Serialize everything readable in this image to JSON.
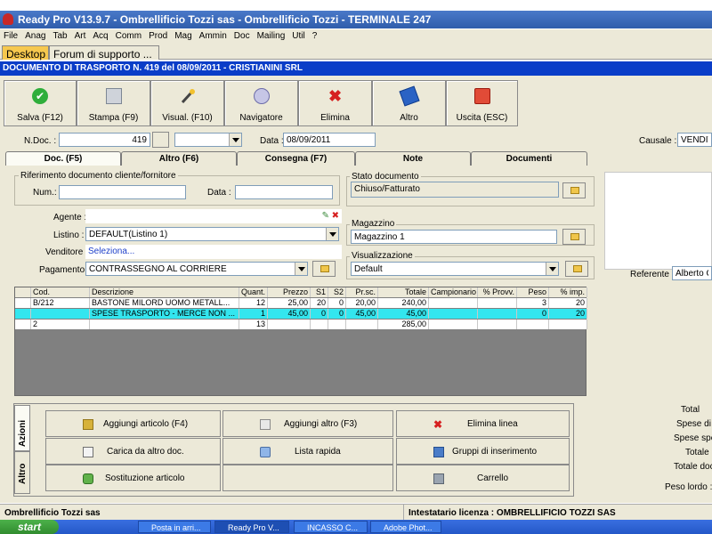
{
  "window": {
    "title": "Ready Pro V13.9.7 - Ombrellificio Tozzi sas - Ombrellificio Tozzi - TERMINALE 247"
  },
  "menu": [
    "File",
    "Anag",
    "Tab",
    "Art",
    "Acq",
    "Comm",
    "Prod",
    "Mag",
    "Ammin",
    "Doc",
    "Mailing",
    "Util",
    "?"
  ],
  "top_tabs": {
    "desktop": "Desktop",
    "forum": "Forum di supporto ..."
  },
  "doc_header": "DOCUMENTO DI TRASPORTO N. 419  del 08/09/2011 - CRISTIANINI SRL",
  "toolbar": {
    "save": "Salva (F12)",
    "print": "Stampa (F9)",
    "view": "Visual. (F10)",
    "navigator": "Navigatore",
    "delete": "Elimina",
    "other": "Altro",
    "exit": "Uscita (ESC)"
  },
  "header_fields": {
    "ndoc_label": "N.Doc. :",
    "ndoc_value": "419",
    "date_label": "Data :",
    "date_value": "08/09/2011",
    "causale_label": "Causale :",
    "causale_value": "VENDITA"
  },
  "sub_tabs": {
    "doc": "Doc. (F5)",
    "altro": "Altro (F6)",
    "consegna": "Consegna (F7)",
    "note": "Note",
    "documenti": "Documenti"
  },
  "rif_group": {
    "title": "Riferimento documento cliente/fornitore",
    "num_label": "Num.:",
    "data_label": "Data :"
  },
  "stato_group": {
    "title": "Stato documento",
    "value": "Chiuso/Fatturato"
  },
  "agente_label": "Agente :",
  "listino": {
    "label": "Listino :",
    "value": "DEFAULT(Listino 1)"
  },
  "venditore": {
    "label": "Venditore :",
    "value": "Seleziona..."
  },
  "pagamento": {
    "label": "Pagamento :",
    "value": "CONTRASSEGNO AL CORRIERE"
  },
  "magazzino": {
    "title": "Magazzino",
    "value": "Magazzino 1"
  },
  "visualizzazione": {
    "title": "Visualizzazione",
    "value": "Default"
  },
  "referente": {
    "label": "Referente",
    "value": "Alberto Cr"
  },
  "grid": {
    "headers": [
      "Cod.",
      "Descrizione",
      "Quant.",
      "Prezzo",
      "S1",
      "S2",
      "Pr.sc.",
      "Totale",
      "Campionario",
      "% Provv.",
      "Peso",
      "% imp."
    ],
    "rows": [
      [
        "B/212",
        "BASTONE MILORD UOMO METALL...",
        "12",
        "25,00",
        "20",
        "0",
        "20,00",
        "240,00",
        "",
        "",
        "3",
        "20"
      ],
      [
        "",
        "SPESE TRASPORTO - MERCE NON ...",
        "1",
        "45,00",
        "0",
        "0",
        "45,00",
        "45,00",
        "",
        "",
        "0",
        "20"
      ],
      [
        "2",
        "",
        "13",
        "",
        "",
        "",
        "",
        "285,00",
        "",
        "",
        "",
        ""
      ]
    ]
  },
  "side_tabs": {
    "azioni": "Azioni",
    "altro": "Altro"
  },
  "actions": {
    "add_article": "Aggiungi articolo (F4)",
    "add_other": "Aggiungi altro (F3)",
    "delete_line": "Elimina linea",
    "load_from_doc": "Carica da altro doc.",
    "quick_list": "Lista rapida",
    "insert_groups": "Gruppi di inserimento",
    "replace_article": "Sostituzione articolo",
    "cart": "Carrello"
  },
  "totals": {
    "total": "Total",
    "spese_i": "Spese di i",
    "spese_spe": "Spese spe",
    "totale_i": "Totale i",
    "totale_doc": "Totale doc",
    "peso_lordo": "Peso lordo :"
  },
  "status": {
    "left": "Ombrellificio Tozzi sas",
    "right": "Intestatario licenza : OMBRELLIFICIO TOZZI SAS"
  },
  "taskbar": {
    "start": "start",
    "items": [
      "Posta in arri...",
      "Ready Pro V...",
      "INCASSO C...",
      "Adobe Phot..."
    ]
  }
}
